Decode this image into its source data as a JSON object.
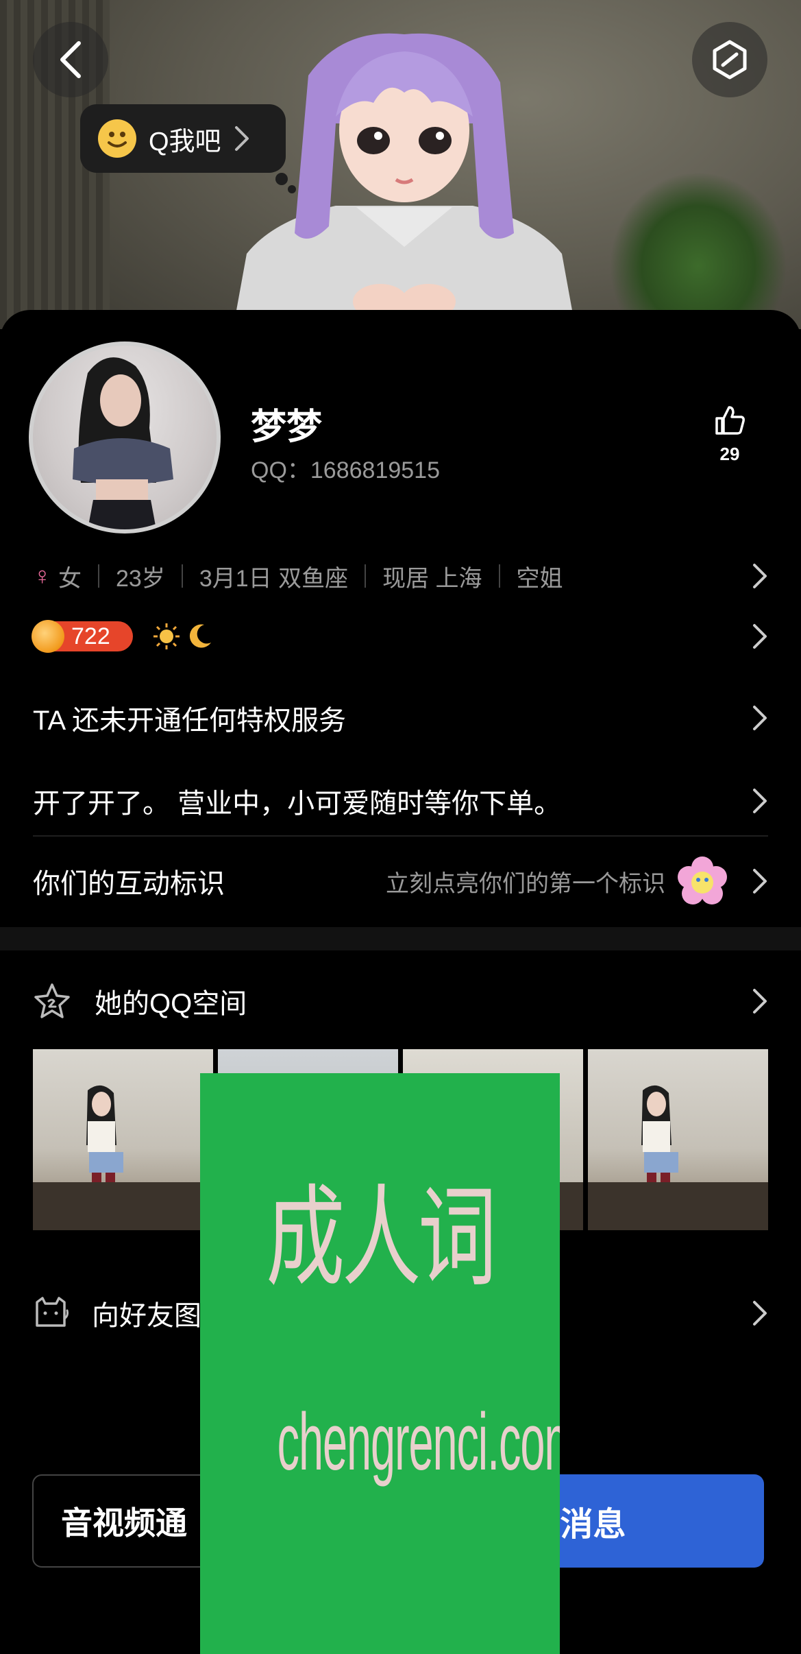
{
  "hero": {
    "bubble_text": "Q我吧"
  },
  "profile": {
    "name": "梦梦",
    "qq_line": "QQ：1686819515",
    "likes": "29",
    "gender": "女",
    "age": "23岁",
    "birthday": "3月1日 双鱼座",
    "location": "现居 上海",
    "job": "空姐",
    "level": "722"
  },
  "rows": {
    "privilege": "TA 还未开通任何特权服务",
    "signature": "开了开了。 营业中，小可爱随时等你下单。",
    "interact_label": "你们的互动标识",
    "interact_hint": "立刻点亮你们的第一个标识",
    "space_label": "她的QQ空间",
    "friend_label": "向好友图"
  },
  "buttons": {
    "call": "音视频通",
    "message": "发消息"
  },
  "watermark": {
    "cn": "成人词",
    "en": "chengrenci.com"
  },
  "colors": {
    "accent": "#2e63d6",
    "level_badge": "#e6452a",
    "watermark_bg": "#22b14c"
  }
}
